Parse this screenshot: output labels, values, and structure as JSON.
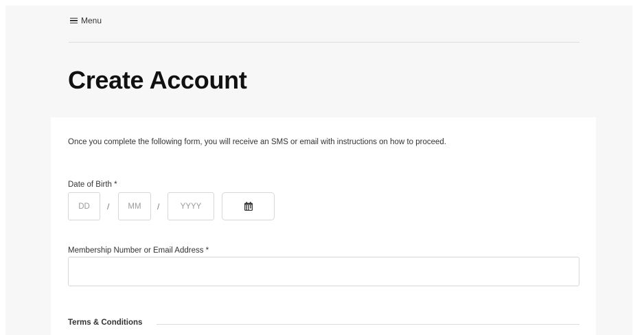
{
  "header": {
    "menu_label": "Menu",
    "menu_icon": "hamburger-icon"
  },
  "page": {
    "title": "Create Account"
  },
  "form": {
    "intro": "Once you complete the following form, you will receive an SMS or email with instructions on how to proceed.",
    "dob": {
      "label": "Date of Birth *",
      "day_placeholder": "DD",
      "month_placeholder": "MM",
      "year_placeholder": "YYYY",
      "separator": "/",
      "calendar_icon": "calendar-icon"
    },
    "membership": {
      "label": "Membership Number or Email Address *",
      "value": ""
    },
    "terms": {
      "heading": "Terms & Conditions"
    }
  }
}
